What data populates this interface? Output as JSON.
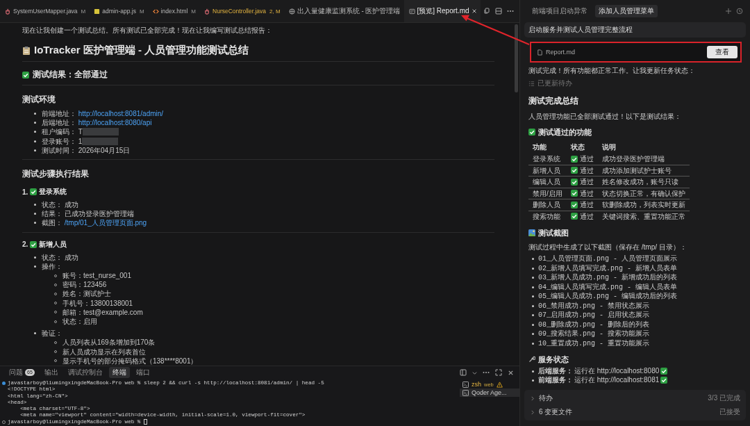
{
  "editor_tabs": [
    {
      "label": "SystemUserMapper.java",
      "status": "M",
      "kind": "java",
      "problems": false,
      "selected": false
    },
    {
      "label": "admin-app.js",
      "status": "M",
      "kind": "js",
      "problems": false,
      "selected": false
    },
    {
      "label": "index.html",
      "status": "M",
      "kind": "html",
      "problems": false,
      "selected": false
    },
    {
      "label": "NurseController.java",
      "status": "2, M",
      "kind": "java",
      "problems": true,
      "selected": false
    },
    {
      "label": "出入量健康监测系统 - 医护管理端",
      "kind": "web",
      "problems": false,
      "selected": false
    },
    {
      "label": "[预览] Report.md",
      "kind": "preview",
      "problems": false,
      "selected": true
    }
  ],
  "document": {
    "intro": "现在让我创建一个测试总结。所有测试已全部完成！现在让我编写测试总结报告：",
    "title": "IoTracker 医护管理端 - 人员管理功能测试总结",
    "result": {
      "text": "测试结果：全部通过",
      "passed": true
    },
    "env_heading": "测试环境",
    "env": [
      {
        "kind": "link",
        "label": "前端地址：",
        "url": "http://localhost:8081/admin/"
      },
      {
        "kind": "link",
        "label": "后端地址：",
        "url": "http://localhost:8080/api"
      },
      {
        "kind": "redacted",
        "label": "租户编码：",
        "text": "T"
      },
      {
        "kind": "redacted",
        "label": "登录账号：",
        "text": "1"
      },
      {
        "kind": "text",
        "label": "测试时间：",
        "text": "2026年04月15日"
      }
    ],
    "steps_heading": "测试步骤执行结果",
    "steps": [
      {
        "number": "1.",
        "title": "登录系统",
        "passed": true,
        "items": [
          {
            "kind": "text",
            "label": "状态：",
            "text": "成功"
          },
          {
            "kind": "text",
            "label": "结果：",
            "text": "已成功登录医护管理端"
          },
          {
            "kind": "link",
            "label": "截图：",
            "url": "/tmp/01_人员管理页面.png"
          }
        ]
      },
      {
        "number": "2.",
        "title": "新增人员",
        "passed": true,
        "items": [
          {
            "kind": "text",
            "label": "状态：",
            "text": "成功"
          },
          {
            "kind": "group",
            "label": "操作：",
            "children": [
              "账号：test_nurse_001",
              "密码：123456",
              "姓名：测试护士",
              "手机号：13800138001",
              "邮箱：test@example.com",
              "状态：启用"
            ]
          },
          {
            "kind": "group",
            "label": "验证：",
            "children": [
              "人员列表从169条增加到170条",
              "新人员成功显示在列表首位",
              "显示手机号的部分掩码格式（138****8001）"
            ]
          }
        ]
      }
    ]
  },
  "panel_tabs": [
    {
      "label": "问题",
      "badge": "65",
      "selected": false
    },
    {
      "label": "输出",
      "selected": false
    },
    {
      "label": "调试控制台",
      "selected": false
    },
    {
      "label": "终端",
      "selected": true
    },
    {
      "label": "端口",
      "selected": false
    }
  ],
  "terminal": {
    "lines": [
      {
        "text": "javastarboy@liumingxingdeMacBook-Pro web % sleep 2 && curl -s http://localhost:8081/admin/ | head -5",
        "kind": "command"
      },
      {
        "text": "<!DOCTYPE html>"
      },
      {
        "text": "<html lang=\"zh-CN\">"
      },
      {
        "text": "<head>"
      },
      {
        "text": "    <meta charset=\"UTF-8\">"
      },
      {
        "text": "    <meta name=\"viewport\" content=\"width=device-width, initial-scale=1.0, viewport-fit=cover\">"
      },
      {
        "text": "javastarboy@liumingxingdeMacBook-Pro web % ",
        "kind": "prompt",
        "cursor": true
      }
    ],
    "sessions": [
      {
        "name": "zsh",
        "detail": "web",
        "warning": true,
        "selected": false
      },
      {
        "name": "Qoder Age...",
        "warning": false,
        "selected": true
      }
    ]
  },
  "agent": {
    "tabs": [
      {
        "label": "前端项目启动异常",
        "selected": false
      },
      {
        "label": "添加人员管理菜单",
        "selected": true
      }
    ],
    "task": "启动服务并测试人员管理完整流程",
    "file_card": {
      "name": "Report.md",
      "button": "查看",
      "highlighted": true
    },
    "message": "测试完成！所有功能都正常工作。让我更新任务状态：",
    "todo_update": "已更新待办",
    "heading": "测试完成总结",
    "summary": "人员管理功能已全部测试通过！以下是测试结果：",
    "features_heading": "测试通过的功能",
    "table": {
      "columns": [
        "功能",
        "状态",
        "说明"
      ],
      "rows": [
        {
          "feature": "登录系统",
          "status": "通过",
          "passed": true,
          "note": "成功登录医护管理端"
        },
        {
          "feature": "新增人员",
          "status": "通过",
          "passed": true,
          "note": "成功添加测试护士账号"
        },
        {
          "feature": "编辑人员",
          "status": "通过",
          "passed": true,
          "note": "姓名修改成功，账号只读"
        },
        {
          "feature": "禁用/启用",
          "status": "通过",
          "passed": true,
          "note": "状态切换正常，有确认保护"
        },
        {
          "feature": "删除人员",
          "status": "通过",
          "passed": true,
          "note": "软删除成功，列表实时更新"
        },
        {
          "feature": "搜索功能",
          "status": "通过",
          "passed": true,
          "note": "关键词搜索、重置功能正常"
        }
      ]
    },
    "screenshots_heading": "测试截图",
    "screenshots_intro": "测试过程中生成了以下截图（保存在 /tmp/ 目录）：",
    "screenshots": [
      "01_人员管理页面.png - 人员管理页面展示",
      "02_新增人员填写完成.png - 新增人员表单",
      "03_新增人员成功.png - 新增成功后的列表",
      "04_编辑人员填写完成.png - 编辑人员表单",
      "05_编辑人员成功.png - 编辑成功后的列表",
      "06_禁用成功.png - 禁用状态展示",
      "07_启用成功.png - 启用状态展示",
      "08_删除成功.png - 删除后的列表",
      "09_搜索结果.png - 搜索功能展示",
      "10_重置成功.png - 重置功能展示"
    ],
    "services_heading": "服务状态",
    "services": [
      {
        "label": "后端服务：",
        "text": "运行在 http://localhost:8080",
        "ok": true
      },
      {
        "label": "前端服务：",
        "text": "运行在 http://localhost:8081",
        "ok": true
      }
    ],
    "footer": [
      {
        "label": "待办",
        "status": "3/3 已完成",
        "expanded": false
      },
      {
        "label": "6 变更文件",
        "status": "已接受",
        "expanded": false
      }
    ]
  }
}
